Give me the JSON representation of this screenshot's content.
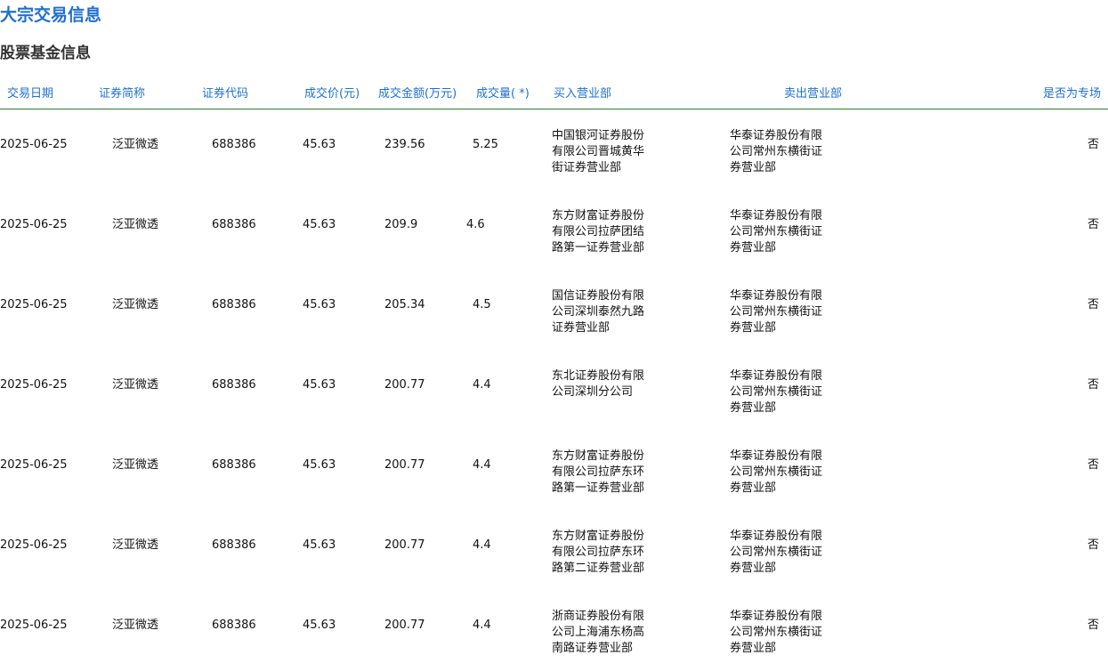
{
  "page": {
    "title": "大宗交易信息",
    "section_title": "股票基金信息"
  },
  "table": {
    "columns": [
      "交易日期",
      "证券简称",
      "证券代码",
      "成交价(元)",
      "成交金额(万元)",
      "成交量( *)",
      "买入营业部",
      "卖出营业部",
      "是否为专场"
    ],
    "rows": [
      {
        "date": "2025-06-25",
        "name": "泛亚微透",
        "code": "688386",
        "price": "45.63",
        "amount": "239.56",
        "volume": "5.25",
        "buyer": "中国银河证券股份有限公司晋城黄华街证券营业部",
        "seller": "华泰证券股份有限公司常州东横街证券营业部",
        "special": "否"
      },
      {
        "date": "2025-06-25",
        "name": "泛亚微透",
        "code": "688386",
        "price": "45.63",
        "amount": "209.9",
        "volume": "4.6",
        "buyer": "东方财富证券股份有限公司拉萨团结路第一证券营业部",
        "seller": "华泰证券股份有限公司常州东横街证券营业部",
        "special": "否"
      },
      {
        "date": "2025-06-25",
        "name": "泛亚微透",
        "code": "688386",
        "price": "45.63",
        "amount": "205.34",
        "volume": "4.5",
        "buyer": "国信证券股份有限公司深圳泰然九路证券营业部",
        "seller": "华泰证券股份有限公司常州东横街证券营业部",
        "special": "否"
      },
      {
        "date": "2025-06-25",
        "name": "泛亚微透",
        "code": "688386",
        "price": "45.63",
        "amount": "200.77",
        "volume": "4.4",
        "buyer": "东北证券股份有限公司深圳分公司",
        "seller": "华泰证券股份有限公司常州东横街证券营业部",
        "special": "否"
      },
      {
        "date": "2025-06-25",
        "name": "泛亚微透",
        "code": "688386",
        "price": "45.63",
        "amount": "200.77",
        "volume": "4.4",
        "buyer": "东方财富证券股份有限公司拉萨东环路第一证券营业部",
        "seller": "华泰证券股份有限公司常州东横街证券营业部",
        "special": "否"
      },
      {
        "date": "2025-06-25",
        "name": "泛亚微透",
        "code": "688386",
        "price": "45.63",
        "amount": "200.77",
        "volume": "4.4",
        "buyer": "东方财富证券股份有限公司拉萨东环路第二证券营业部",
        "seller": "华泰证券股份有限公司常州东横街证券营业部",
        "special": "否"
      },
      {
        "date": "2025-06-25",
        "name": "泛亚微透",
        "code": "688386",
        "price": "45.63",
        "amount": "200.77",
        "volume": "4.4",
        "buyer": "浙商证券股份有限公司上海浦东杨高南路证券营业部",
        "seller": "华泰证券股份有限公司常州东横街证券营业部",
        "special": "否"
      }
    ]
  }
}
